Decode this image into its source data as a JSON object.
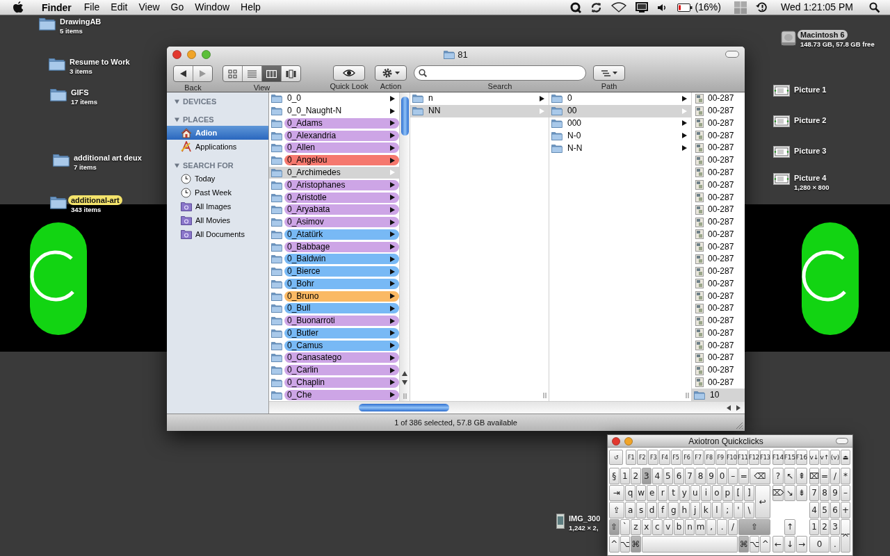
{
  "menu_bar": {
    "app_name": "Finder",
    "menus": [
      "File",
      "Edit",
      "View",
      "Go",
      "Window",
      "Help"
    ],
    "battery_reading": "(16%)",
    "clock": "Wed 1:21:05 PM"
  },
  "desktop_icons": [
    {
      "kind": "folder",
      "name": "DrawingAB",
      "info": "5 items"
    },
    {
      "kind": "folder",
      "name": "Resume to Work",
      "info": "3 items"
    },
    {
      "kind": "folder",
      "name": "GIFS",
      "info": "17 items"
    },
    {
      "kind": "folder",
      "name": "additional art deux",
      "info": "7 items"
    },
    {
      "kind": "folder",
      "name": "additional-art",
      "info": "343 items",
      "color": "#f4e36b"
    },
    {
      "kind": "drive",
      "name": "Macintosh 6",
      "info": "148.73 GB, 57.8 GB free",
      "color": "#c9c9c9"
    },
    {
      "kind": "screenshot",
      "name": "Picture 1"
    },
    {
      "kind": "screenshot",
      "name": "Picture 2"
    },
    {
      "kind": "screenshot",
      "name": "Picture 3"
    },
    {
      "kind": "screenshot",
      "name": "Picture 4",
      "info": "1,280 × 800"
    },
    {
      "kind": "photo",
      "name": "IMG_300",
      "info": "1,242 × 2,"
    }
  ],
  "finder_window": {
    "title": "81",
    "toolbar": {
      "back_label": "Back",
      "views": [
        {
          "kind": "icon",
          "selected": false
        },
        {
          "kind": "list",
          "selected": false
        },
        {
          "kind": "column",
          "selected": true
        },
        {
          "kind": "coverflow",
          "selected": false
        }
      ],
      "view_label": "View",
      "quick_look_label": "Quick Look",
      "action_label": "Action",
      "search_label": "Search",
      "path_label": "Path"
    },
    "sidebar": [
      {
        "heading": "DEVICES",
        "expanded": true
      },
      {
        "heading": "PLACES",
        "expanded": true,
        "items": [
          {
            "kind": "home",
            "label": "Adion",
            "selected": true
          },
          {
            "kind": "apps",
            "label": "Applications",
            "selected": false
          }
        ]
      },
      {
        "heading": "SEARCH FOR",
        "expanded": true,
        "items": [
          {
            "kind": "clock",
            "label": "Today",
            "selected": false
          },
          {
            "kind": "clock",
            "label": "Past Week",
            "selected": false
          },
          {
            "kind": "smart",
            "label": "All Images",
            "selected": false
          },
          {
            "kind": "smart",
            "label": "All Movies",
            "selected": false
          },
          {
            "kind": "smart",
            "label": "All Documents",
            "selected": false
          }
        ]
      }
    ],
    "columns": [
      {
        "items": [
          {
            "kind": "folder",
            "name": "0_0",
            "selected": false
          },
          {
            "kind": "folder",
            "name": "0_0_Naught-N",
            "selected": false
          },
          {
            "kind": "folder",
            "name": "0_Adams",
            "selected": false,
            "color": "#cda5e6"
          },
          {
            "kind": "folder",
            "name": "0_Alexandria",
            "selected": false,
            "color": "#cda5e6"
          },
          {
            "kind": "folder",
            "name": "0_Allen",
            "selected": false,
            "color": "#cda5e6"
          },
          {
            "kind": "folder",
            "name": "0_Angelou",
            "selected": false,
            "color": "#f5786e"
          },
          {
            "kind": "folder",
            "name": "0_Archimedes",
            "selected": true
          },
          {
            "kind": "folder",
            "name": "0_Aristophanes",
            "selected": false,
            "color": "#cda5e6"
          },
          {
            "kind": "folder",
            "name": "0_Aristotle",
            "selected": false,
            "color": "#cda5e6"
          },
          {
            "kind": "folder",
            "name": "0_Aryabata",
            "selected": false,
            "color": "#cda5e6"
          },
          {
            "kind": "folder",
            "name": "0_Asimov",
            "selected": false,
            "color": "#cda5e6"
          },
          {
            "kind": "folder",
            "name": "0_Atatürk",
            "selected": false,
            "color": "#78b9f5"
          },
          {
            "kind": "folder",
            "name": "0_Babbage",
            "selected": false,
            "color": "#cda5e6"
          },
          {
            "kind": "folder",
            "name": "0_Baldwin",
            "selected": false,
            "color": "#78b9f5"
          },
          {
            "kind": "folder",
            "name": "0_Bierce",
            "selected": false,
            "color": "#78b9f5"
          },
          {
            "kind": "folder",
            "name": "0_Bohr",
            "selected": false,
            "color": "#78b9f5"
          },
          {
            "kind": "folder",
            "name": "0_Bruno",
            "selected": false,
            "color": "#fab964"
          },
          {
            "kind": "folder",
            "name": "0_Bull",
            "selected": false,
            "color": "#78b9f5"
          },
          {
            "kind": "folder",
            "name": "0_Buonarroti",
            "selected": false,
            "color": "#cda5e6"
          },
          {
            "kind": "folder",
            "name": "0_Butler",
            "selected": false,
            "color": "#78b9f5"
          },
          {
            "kind": "folder",
            "name": "0_Camus",
            "selected": false,
            "color": "#78b9f5"
          },
          {
            "kind": "folder",
            "name": "0_Canasatego",
            "selected": false,
            "color": "#cda5e6"
          },
          {
            "kind": "folder",
            "name": "0_Carlin",
            "selected": false,
            "color": "#cda5e6"
          },
          {
            "kind": "folder",
            "name": "0_Chaplin",
            "selected": false,
            "color": "#cda5e6"
          },
          {
            "kind": "folder",
            "name": "0_Che",
            "selected": false,
            "color": "#cda5e6"
          }
        ]
      },
      {
        "items": [
          {
            "kind": "folder",
            "name": "n",
            "selected": false
          },
          {
            "kind": "folder",
            "name": "NN",
            "selected": true
          }
        ]
      },
      {
        "items": [
          {
            "kind": "folder",
            "name": "0",
            "selected": false
          },
          {
            "kind": "folder",
            "name": "00",
            "selected": true
          },
          {
            "kind": "folder",
            "name": "000",
            "selected": false
          },
          {
            "kind": "folder",
            "name": "N-0",
            "selected": false
          },
          {
            "kind": "folder",
            "name": "N-N",
            "selected": false
          }
        ]
      },
      {
        "items": [
          {
            "kind": "image",
            "name": "00-287",
            "selected": false
          },
          {
            "kind": "image",
            "name": "00-287",
            "selected": false
          },
          {
            "kind": "image",
            "name": "00-287",
            "selected": false
          },
          {
            "kind": "image",
            "name": "00-287",
            "selected": false
          },
          {
            "kind": "image",
            "name": "00-287",
            "selected": false
          },
          {
            "kind": "image",
            "name": "00-287",
            "selected": false
          },
          {
            "kind": "image",
            "name": "00-287",
            "selected": false
          },
          {
            "kind": "image",
            "name": "00-287",
            "selected": false
          },
          {
            "kind": "image",
            "name": "00-287",
            "selected": false
          },
          {
            "kind": "image",
            "name": "00-287",
            "selected": false
          },
          {
            "kind": "image",
            "name": "00-287",
            "selected": false
          },
          {
            "kind": "image",
            "name": "00-287",
            "selected": false
          },
          {
            "kind": "image",
            "name": "00-287",
            "selected": false
          },
          {
            "kind": "image",
            "name": "00-287",
            "selected": false
          },
          {
            "kind": "image",
            "name": "00-287",
            "selected": false
          },
          {
            "kind": "image",
            "name": "00-287",
            "selected": false
          },
          {
            "kind": "image",
            "name": "00-287",
            "selected": false
          },
          {
            "kind": "image",
            "name": "00-287",
            "selected": false
          },
          {
            "kind": "image",
            "name": "00-287",
            "selected": false
          },
          {
            "kind": "image",
            "name": "00-287",
            "selected": false
          },
          {
            "kind": "image",
            "name": "00-287",
            "selected": false
          },
          {
            "kind": "image",
            "name": "00-287",
            "selected": false
          },
          {
            "kind": "image",
            "name": "00-287",
            "selected": false
          },
          {
            "kind": "image",
            "name": "00-287",
            "selected": false
          },
          {
            "kind": "folder",
            "name": "10",
            "selected": true
          }
        ]
      }
    ],
    "status": "1 of 386 selected, 57.8 GB available"
  },
  "keyboard_window": {
    "title": "Axiotron Quickclicks",
    "sections": [
      {
        "kind": "main",
        "top_keys": [
          {
            "label": "↺",
            "kind": "wide",
            "pressed": false
          },
          {
            "label": "F1",
            "kind": "key",
            "pressed": false
          },
          {
            "label": "F2",
            "kind": "key",
            "pressed": false
          },
          {
            "label": "F3",
            "kind": "key",
            "pressed": false
          },
          {
            "label": "F4",
            "kind": "key",
            "pressed": false
          },
          {
            "label": "F5",
            "kind": "key",
            "pressed": false
          },
          {
            "label": "F6",
            "kind": "key",
            "pressed": false
          },
          {
            "label": "F7",
            "kind": "key",
            "pressed": false
          },
          {
            "label": "F8",
            "kind": "key",
            "pressed": false
          },
          {
            "label": "F9",
            "kind": "key",
            "pressed": false
          },
          {
            "label": "F10",
            "kind": "key",
            "pressed": false
          },
          {
            "label": "F11",
            "kind": "key",
            "pressed": false
          },
          {
            "label": "F12",
            "kind": "key",
            "pressed": false
          },
          {
            "label": "F13",
            "kind": "key",
            "pressed": false
          }
        ],
        "keys": [
          {
            "label": "§",
            "kind": "key",
            "pressed": false
          },
          {
            "label": "1",
            "kind": "key",
            "pressed": false
          },
          {
            "label": "2",
            "kind": "key",
            "pressed": false
          },
          {
            "label": "3",
            "kind": "key",
            "pressed": true
          },
          {
            "label": "4",
            "kind": "key",
            "pressed": false
          },
          {
            "label": "5",
            "kind": "key",
            "pressed": false
          },
          {
            "label": "6",
            "kind": "key",
            "pressed": false
          },
          {
            "label": "7",
            "kind": "key",
            "pressed": false
          },
          {
            "label": "8",
            "kind": "key",
            "pressed": false
          },
          {
            "label": "9",
            "kind": "key",
            "pressed": false
          },
          {
            "label": "0",
            "kind": "key",
            "pressed": false
          },
          {
            "label": "–",
            "kind": "key",
            "pressed": false
          },
          {
            "label": "=",
            "kind": "key",
            "pressed": false
          },
          {
            "label": "⌫",
            "kind": "long",
            "pressed": false
          },
          {
            "label": "⇥",
            "kind": "wide",
            "pressed": false
          },
          {
            "label": "q",
            "kind": "key",
            "pressed": false
          },
          {
            "label": "w",
            "kind": "key",
            "pressed": false
          },
          {
            "label": "e",
            "kind": "key",
            "pressed": false
          },
          {
            "label": "r",
            "kind": "key",
            "pressed": false
          },
          {
            "label": "t",
            "kind": "key",
            "pressed": false
          },
          {
            "label": "y",
            "kind": "key",
            "pressed": false
          },
          {
            "label": "u",
            "kind": "key",
            "pressed": false
          },
          {
            "label": "i",
            "kind": "key",
            "pressed": false
          },
          {
            "label": "o",
            "kind": "key",
            "pressed": false
          },
          {
            "label": "p",
            "kind": "key",
            "pressed": false
          },
          {
            "label": "[",
            "kind": "key",
            "pressed": false
          },
          {
            "label": "]",
            "kind": "key",
            "pressed": false
          },
          {
            "label": "↩",
            "kind": "tall",
            "pressed": false
          },
          {
            "label": "⇪",
            "kind": "wide",
            "pressed": false
          },
          {
            "label": "a",
            "kind": "key",
            "pressed": false
          },
          {
            "label": "s",
            "kind": "key",
            "pressed": false
          },
          {
            "label": "d",
            "kind": "key",
            "pressed": false
          },
          {
            "label": "f",
            "kind": "key",
            "pressed": false
          },
          {
            "label": "g",
            "kind": "key",
            "pressed": false
          },
          {
            "label": "h",
            "kind": "key",
            "pressed": false
          },
          {
            "label": "j",
            "kind": "key",
            "pressed": false
          },
          {
            "label": "k",
            "kind": "key",
            "pressed": false
          },
          {
            "label": "l",
            "kind": "key",
            "pressed": false
          },
          {
            "label": ";",
            "kind": "key",
            "pressed": false
          },
          {
            "label": "'",
            "kind": "key",
            "pressed": false
          },
          {
            "label": "\\",
            "kind": "key",
            "pressed": false
          },
          {
            "label": "⇧",
            "kind": "key",
            "pressed": true
          },
          {
            "label": "`",
            "kind": "key",
            "pressed": false
          },
          {
            "label": "z",
            "kind": "key",
            "pressed": false
          },
          {
            "label": "x",
            "kind": "key",
            "pressed": false
          },
          {
            "label": "c",
            "kind": "key",
            "pressed": false
          },
          {
            "label": "v",
            "kind": "key",
            "pressed": false
          },
          {
            "label": "b",
            "kind": "key",
            "pressed": false
          },
          {
            "label": "n",
            "kind": "key",
            "pressed": false
          },
          {
            "label": "m",
            "kind": "key",
            "pressed": false
          },
          {
            "label": ",",
            "kind": "key",
            "pressed": false
          },
          {
            "label": ".",
            "kind": "key",
            "pressed": false
          },
          {
            "label": "/",
            "kind": "key",
            "pressed": false
          },
          {
            "label": "⇧",
            "kind": "broad",
            "pressed": true
          },
          {
            "label": "^",
            "kind": "key",
            "pressed": false
          },
          {
            "label": "⌥",
            "kind": "key",
            "pressed": false
          },
          {
            "label": "⌘",
            "kind": "key",
            "pressed": true
          },
          {
            "kind": "space",
            "pressed": false
          },
          {
            "label": "⌘",
            "kind": "key",
            "pressed": true
          },
          {
            "label": "⌥",
            "kind": "key",
            "pressed": false
          },
          {
            "label": "^",
            "kind": "key",
            "pressed": false
          }
        ]
      },
      {
        "kind": "nav",
        "top_keys": [
          {
            "label": "F14",
            "kind": "key",
            "pressed": false
          },
          {
            "label": "F15",
            "kind": "key",
            "pressed": false
          },
          {
            "label": "F16",
            "kind": "key",
            "pressed": false
          }
        ],
        "keys": [
          {
            "label": "?",
            "kind": "key",
            "pressed": false
          },
          {
            "label": "↖",
            "kind": "key",
            "pressed": false
          },
          {
            "label": "⇞",
            "kind": "key",
            "pressed": false
          },
          {
            "label": "⌦",
            "kind": "key",
            "pressed": false
          },
          {
            "label": "↘",
            "kind": "key",
            "pressed": false
          },
          {
            "label": "⇟",
            "kind": "key",
            "pressed": false
          },
          {
            "label": "↑",
            "kind": "up",
            "pressed": false
          },
          {
            "label": "←",
            "kind": "arrow",
            "pressed": false
          },
          {
            "label": "↓",
            "kind": "arrow",
            "pressed": false
          },
          {
            "label": "→",
            "kind": "arrow",
            "pressed": false
          }
        ]
      },
      {
        "kind": "numpad",
        "top_keys": [
          {
            "label": "v↓",
            "kind": "key",
            "pressed": false
          },
          {
            "label": "v↑",
            "kind": "key",
            "pressed": false
          },
          {
            "label": "(v)",
            "kind": "key",
            "pressed": false
          },
          {
            "label": "⏏",
            "kind": "key",
            "pressed": false
          }
        ],
        "keys": [
          {
            "label": "⌧",
            "kind": "key",
            "pressed": false
          },
          {
            "label": "=",
            "kind": "key",
            "pressed": false
          },
          {
            "label": "/",
            "kind": "key",
            "pressed": false
          },
          {
            "label": "*",
            "kind": "key",
            "pressed": false
          },
          {
            "label": "7",
            "kind": "key",
            "pressed": false
          },
          {
            "label": "8",
            "kind": "key",
            "pressed": false
          },
          {
            "label": "9",
            "kind": "key",
            "pressed": false
          },
          {
            "label": "–",
            "kind": "key",
            "pressed": false
          },
          {
            "label": "4",
            "kind": "key",
            "pressed": false
          },
          {
            "label": "5",
            "kind": "key",
            "pressed": false
          },
          {
            "label": "6",
            "kind": "key",
            "pressed": false
          },
          {
            "label": "+",
            "kind": "key",
            "pressed": false
          },
          {
            "label": "1",
            "kind": "key",
            "pressed": false
          },
          {
            "label": "2",
            "kind": "key",
            "pressed": false
          },
          {
            "label": "3",
            "kind": "key",
            "pressed": false
          },
          {
            "label": "⌤",
            "kind": "tall",
            "pressed": false
          },
          {
            "label": "0",
            "kind": "wide",
            "pressed": false
          },
          {
            "label": ".",
            "kind": "key",
            "pressed": false
          }
        ]
      }
    ]
  }
}
